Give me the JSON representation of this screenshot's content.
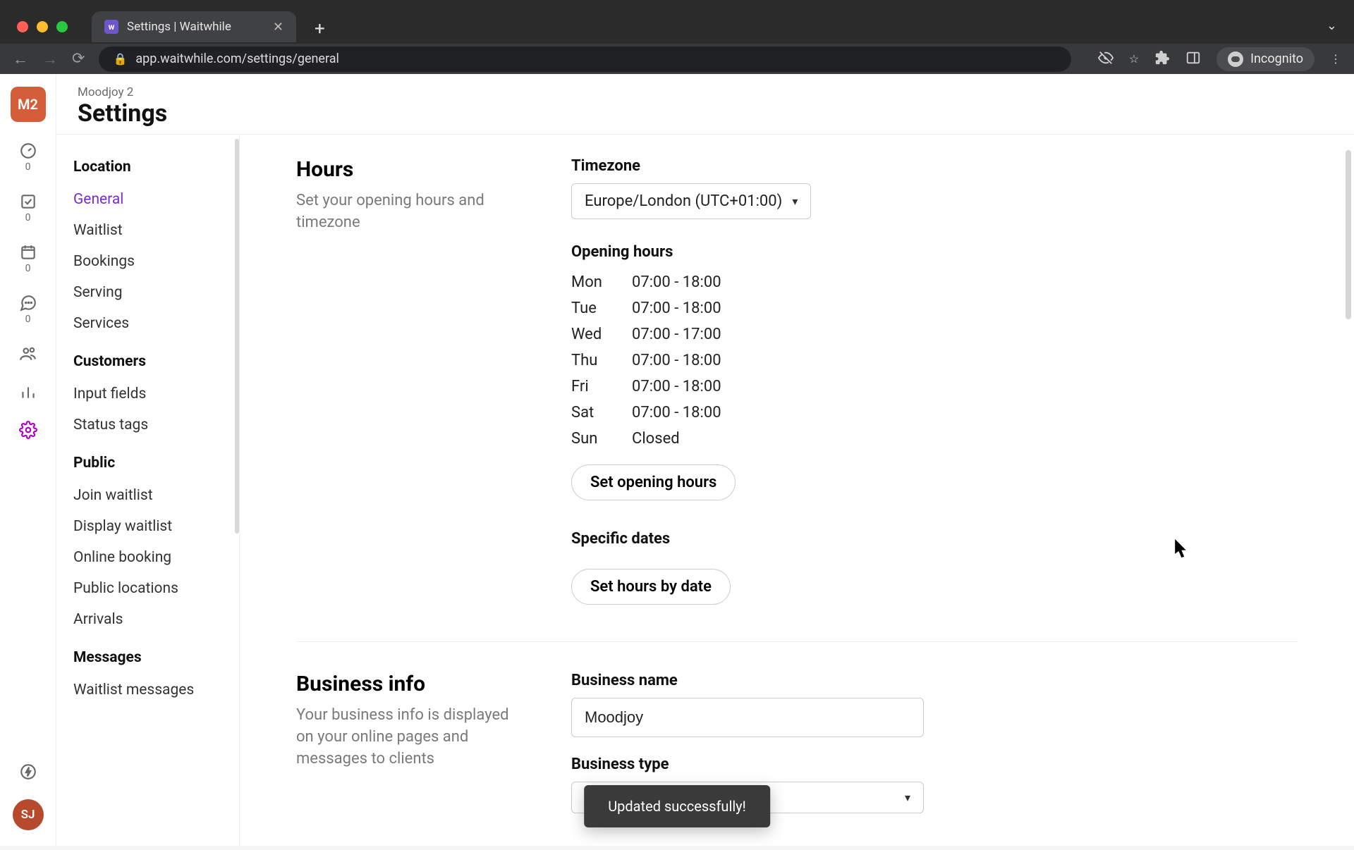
{
  "browser": {
    "tab_title": "Settings | Waitwhile",
    "url": "app.waitwhile.com/settings/general",
    "incognito_label": "Incognito"
  },
  "rail": {
    "org_initials": "M2",
    "counts": {
      "queue": "0",
      "check": "0",
      "calendar": "0",
      "chat": "0"
    },
    "avatar_initials": "SJ"
  },
  "header": {
    "workspace": "Moodjoy 2",
    "title": "Settings"
  },
  "sidebar": {
    "sections": [
      {
        "title": "Location",
        "items": [
          "General",
          "Waitlist",
          "Bookings",
          "Serving",
          "Services"
        ],
        "active_index": 0
      },
      {
        "title": "Customers",
        "items": [
          "Input fields",
          "Status tags"
        ]
      },
      {
        "title": "Public",
        "items": [
          "Join waitlist",
          "Display waitlist",
          "Online booking",
          "Public locations",
          "Arrivals"
        ]
      },
      {
        "title": "Messages",
        "items": [
          "Waitlist messages"
        ]
      }
    ]
  },
  "hours_section": {
    "title": "Hours",
    "subtitle": "Set your opening hours and timezone",
    "timezone_label": "Timezone",
    "timezone_value": "Europe/London (UTC+01:00)",
    "opening_hours_label": "Opening hours",
    "rows": [
      {
        "day": "Mon",
        "hours": "07:00 - 18:00"
      },
      {
        "day": "Tue",
        "hours": "07:00 - 18:00"
      },
      {
        "day": "Wed",
        "hours": "07:00 - 17:00"
      },
      {
        "day": "Thu",
        "hours": "07:00 - 18:00"
      },
      {
        "day": "Fri",
        "hours": "07:00 - 18:00"
      },
      {
        "day": "Sat",
        "hours": "07:00 - 18:00"
      },
      {
        "day": "Sun",
        "hours": "Closed"
      }
    ],
    "set_hours_btn": "Set opening hours",
    "specific_dates_label": "Specific dates",
    "set_by_date_btn": "Set hours by date"
  },
  "business_section": {
    "title": "Business info",
    "subtitle": "Your business info is displayed on your online pages and messages to clients",
    "name_label": "Business name",
    "name_value": "Moodjoy",
    "type_label": "Business type",
    "type_value": ""
  },
  "toast": {
    "message": "Updated successfully!"
  }
}
